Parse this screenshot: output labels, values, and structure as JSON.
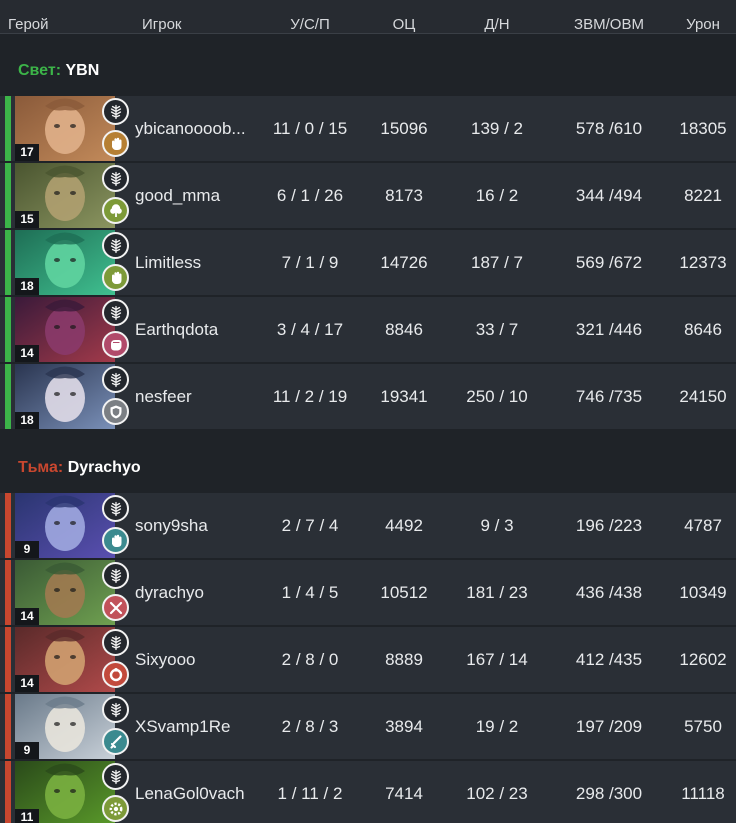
{
  "header": {
    "hero": "Герой",
    "player": "Игрок",
    "kda": "У/С/П",
    "score": "ОЦ",
    "lhdn": "Д/Н",
    "xpm_gpm": "ЗВМ/ОВМ",
    "damage": "Урон"
  },
  "colors": {
    "radiant": "#3cb449",
    "dire": "#c8472f",
    "background": "#1f2328",
    "row": "#2a2f36"
  },
  "radiant": {
    "side_label": "Свет:",
    "team_name": "YBN",
    "players": [
      {
        "level": "17",
        "name": "ybicanoooob...",
        "kda": "11 / 0 / 15",
        "score": "15096",
        "lhdn": "139 / 2",
        "xpm_gpm": "578 /610",
        "damage": "18305",
        "role_icon": "hand-icon",
        "role_color": "#b67f33"
      },
      {
        "level": "15",
        "name": "good_mma",
        "kda": "6 / 1 / 26",
        "score": "8173",
        "lhdn": "16 / 2",
        "xpm_gpm": "344 /494",
        "damage": "8221",
        "role_icon": "tree-icon",
        "role_color": "#7d9a38"
      },
      {
        "level": "18",
        "name": "Limitless",
        "kda": "7 / 1 / 9",
        "score": "14726",
        "lhdn": "187 / 7",
        "xpm_gpm": "569 /672",
        "damage": "12373",
        "role_icon": "hand-icon",
        "role_color": "#7d9a38"
      },
      {
        "level": "14",
        "name": "Earthqdota",
        "kda": "3 / 4 / 17",
        "score": "8846",
        "lhdn": "33 / 7",
        "xpm_gpm": "321 /446",
        "damage": "8646",
        "role_icon": "fist-icon",
        "role_color": "#b14a6a"
      },
      {
        "level": "18",
        "name": "nesfeer",
        "kda": "11 / 2 / 19",
        "score": "19341",
        "lhdn": "250 / 10",
        "xpm_gpm": "746 /735",
        "damage": "24150",
        "role_icon": "shield-icon",
        "role_color": "#7b7f84"
      }
    ]
  },
  "dire": {
    "side_label": "Тьма:",
    "team_name": "Dyrachyo",
    "players": [
      {
        "level": "9",
        "name": "sony9sha",
        "kda": "2 / 7 / 4",
        "score": "4492",
        "lhdn": "9 / 3",
        "xpm_gpm": "196 /223",
        "damage": "4787",
        "role_icon": "hand-icon",
        "role_color": "#3b8a8f"
      },
      {
        "level": "14",
        "name": "dyrachyo",
        "kda": "1 / 4 / 5",
        "score": "10512",
        "lhdn": "181 / 23",
        "xpm_gpm": "436 /438",
        "damage": "10349",
        "role_icon": "swords-icon",
        "role_color": "#c1525a"
      },
      {
        "level": "14",
        "name": "Sixyooo",
        "kda": "2 / 8 / 0",
        "score": "8889",
        "lhdn": "167 / 14",
        "xpm_gpm": "412 /435",
        "damage": "12602",
        "role_icon": "ring-icon",
        "role_color": "#c24a3c"
      },
      {
        "level": "9",
        "name": "XSvamp1Re",
        "kda": "2 / 8 / 3",
        "score": "3894",
        "lhdn": "19 / 2",
        "xpm_gpm": "197 /209",
        "damage": "5750",
        "role_icon": "sword-icon",
        "role_color": "#3b8a8f"
      },
      {
        "level": "11",
        "name": "LenaGol0vach",
        "kda": "1 / 11 / 2",
        "score": "7414",
        "lhdn": "102 / 23",
        "xpm_gpm": "298 /300",
        "damage": "11118",
        "role_icon": "gear-icon",
        "role_color": "#7d9a38"
      }
    ]
  },
  "heroes": [
    {
      "portrait": "hero-portrait-dawnbreaker",
      "bg1": "#8a5a3a",
      "bg2": "#c28a5a",
      "face": "#e0b08a"
    },
    {
      "portrait": "hero-portrait-treant",
      "bg1": "#4a5530",
      "bg2": "#8b9560",
      "face": "#b0a070"
    },
    {
      "portrait": "hero-portrait-venomancer",
      "bg1": "#1e6e55",
      "bg2": "#40c090",
      "face": "#5fd4a0"
    },
    {
      "portrait": "hero-portrait-bane",
      "bg1": "#3a1a3a",
      "bg2": "#a23a4a",
      "face": "#8a3a6a"
    },
    {
      "portrait": "hero-portrait-luna",
      "bg1": "#2a3550",
      "bg2": "#7a90b8",
      "face": "#e0dce8"
    },
    {
      "portrait": "hero-portrait-vengeful",
      "bg1": "#2a3570",
      "bg2": "#5a4fb0",
      "face": "#a0a8e0"
    },
    {
      "portrait": "hero-portrait-huskar",
      "bg1": "#3a5a35",
      "bg2": "#6fa050",
      "face": "#a07a50"
    },
    {
      "portrait": "hero-portrait-techies",
      "bg1": "#5a2a2a",
      "bg2": "#b04a4a",
      "face": "#d0a070"
    },
    {
      "portrait": "hero-portrait-tusk",
      "bg1": "#6a7a8a",
      "bg2": "#c8d0d8",
      "face": "#e8e4dc"
    },
    {
      "portrait": "hero-portrait-venom",
      "bg1": "#2a4a1a",
      "bg2": "#5a9a2a",
      "face": "#7ab040"
    }
  ]
}
